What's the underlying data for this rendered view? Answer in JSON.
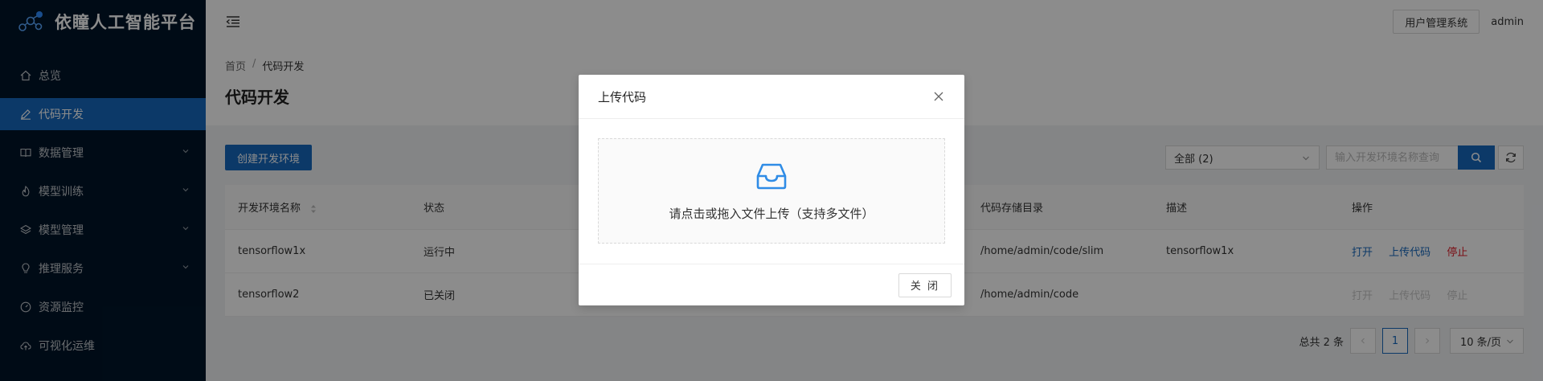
{
  "app": {
    "title": "依瞳人工智能平台"
  },
  "sidebar": {
    "items": [
      {
        "label": "总览",
        "icon": "home-icon",
        "active": false,
        "expandable": false
      },
      {
        "label": "代码开发",
        "icon": "edit-icon",
        "active": true,
        "expandable": false
      },
      {
        "label": "数据管理",
        "icon": "book-icon",
        "active": false,
        "expandable": true
      },
      {
        "label": "模型训练",
        "icon": "fire-icon",
        "active": false,
        "expandable": true
      },
      {
        "label": "模型管理",
        "icon": "layers-icon",
        "active": false,
        "expandable": true
      },
      {
        "label": "推理服务",
        "icon": "bulb-icon",
        "active": false,
        "expandable": true
      },
      {
        "label": "资源监控",
        "icon": "dashboard-icon",
        "active": false,
        "expandable": false
      },
      {
        "label": "可视化运维",
        "icon": "cloud-upload-icon",
        "active": false,
        "expandable": false
      }
    ]
  },
  "header": {
    "system_button": "用户管理系统",
    "user": "admin"
  },
  "breadcrumb": {
    "home": "首页",
    "separator": "/",
    "current": "代码开发"
  },
  "page": {
    "title": "代码开发"
  },
  "toolbar": {
    "create_button": "创建开发环境",
    "filter_value": "全部 (2)",
    "search_placeholder": "输入开发环境名称查询"
  },
  "table": {
    "headers": {
      "name": "开发环境名称",
      "status": "状态",
      "col3": "",
      "col4": "",
      "dir": "代码存储目录",
      "desc": "描述",
      "ops": "操作"
    },
    "rows": [
      {
        "name": "tensorflow1x",
        "status": "运行中",
        "dir": "/home/admin/code/slim",
        "desc": "tensorflow1x",
        "open": "打开",
        "upload": "上传代码",
        "stop": "停止",
        "enabled": true
      },
      {
        "name": "tensorflow2",
        "status": "已关闭",
        "dir": "/home/admin/code",
        "desc": "",
        "open": "打开",
        "upload": "上传代码",
        "stop": "停止",
        "enabled": false
      }
    ]
  },
  "pagination": {
    "total": "总共 2 条",
    "current_page": "1",
    "page_size": "10 条/页"
  },
  "modal": {
    "title": "上传代码",
    "dropzone_text": "请点击或拖入文件上传（支持多文件）",
    "close_button": "关 闭"
  },
  "colors": {
    "primary": "#1769be",
    "sidebar_bg": "#001529",
    "danger": "#e0202b"
  }
}
